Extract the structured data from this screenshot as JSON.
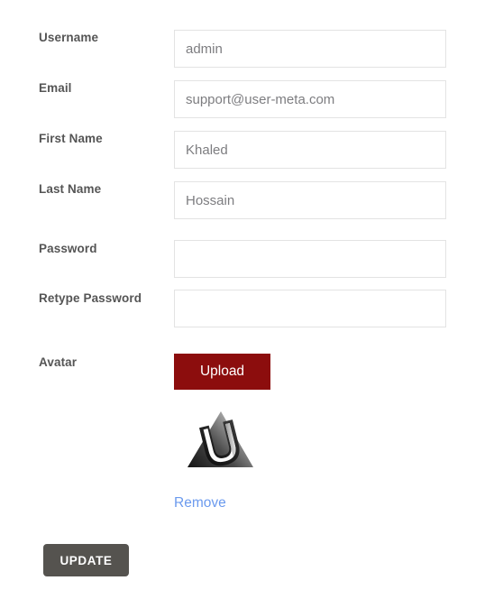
{
  "form": {
    "fields": [
      {
        "label": "Username",
        "value": "admin",
        "type": "text"
      },
      {
        "label": "Email",
        "value": "support@user-meta.com",
        "type": "text"
      },
      {
        "label": "First Name",
        "value": "Khaled",
        "type": "text"
      },
      {
        "label": "Last Name",
        "value": "Hossain",
        "type": "text"
      },
      {
        "label": "Password",
        "value": "",
        "type": "password"
      },
      {
        "label": "Retype Password",
        "value": "",
        "type": "password"
      }
    ],
    "avatar": {
      "label": "Avatar",
      "upload_label": "Upload",
      "remove_label": "Remove",
      "image_name": "user-meta-u-logo-avatar"
    },
    "submit_label": "UPDATE"
  },
  "colors": {
    "upload_button_bg": "#8c0d0d",
    "update_button_bg": "#55534f",
    "remove_link": "#6b9aee",
    "label_text": "#555555",
    "input_text": "#7d7d80",
    "input_border": "#e3e3e3",
    "page_bg": "#ffffff"
  }
}
